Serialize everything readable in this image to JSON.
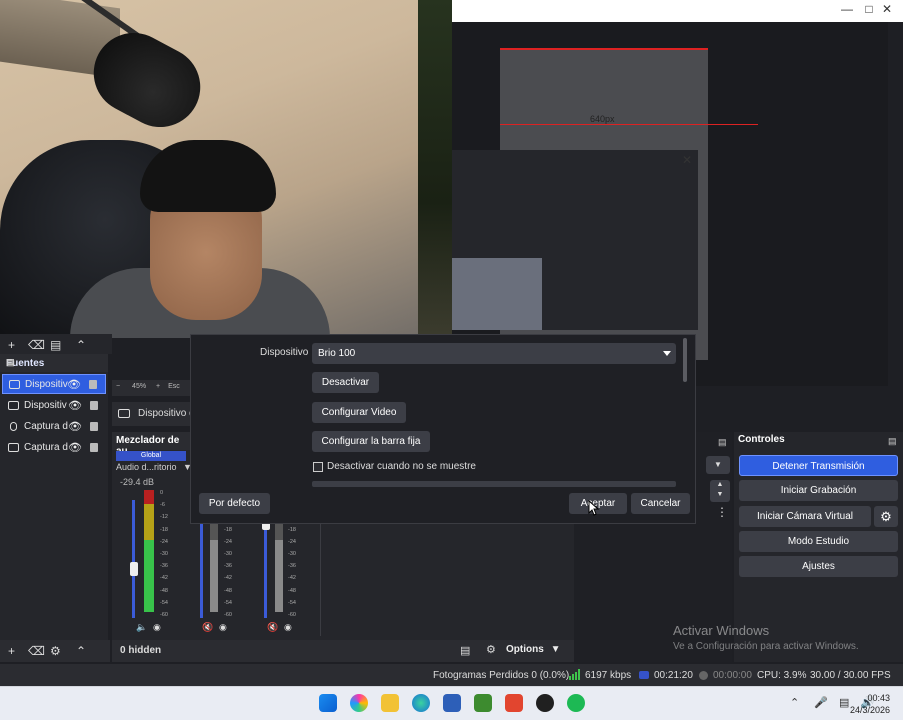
{
  "obs": {
    "sources": {
      "title": "Fuentes",
      "items": [
        {
          "label": "Dispositiv",
          "selected": true,
          "icon": "camera-icon"
        },
        {
          "label": "Dispositiv",
          "selected": false,
          "icon": "camera-icon"
        },
        {
          "label": "Captura d",
          "selected": false,
          "icon": "mic-icon"
        },
        {
          "label": "Captura d",
          "selected": false,
          "icon": "monitor-icon"
        }
      ]
    },
    "preview_zoom": "45%",
    "preview_zoom_suffix": "Esc",
    "nested_resolution": "640px",
    "properties_source": "Dispositivo d",
    "mixer": {
      "title": "Mezclador de au",
      "global_tag": "Global",
      "channel_name": "Audio d...ritorio",
      "db_value": "-29.4 dB",
      "scale": [
        "0",
        "-6",
        "-12",
        "-18",
        "-24",
        "-30",
        "-36",
        "-42",
        "-48",
        "-54",
        "-60"
      ],
      "hidden_label": "0 hidden",
      "options_label": "Options"
    },
    "dialog": {
      "device_label": "Dispositivo",
      "device_value": "Brio 100",
      "buttons": {
        "deactivate": "Desactivar",
        "configure_video": "Configurar Video",
        "configure_bar": "Configurar la barra fija"
      },
      "checkbox_label": "Desactivar cuando no se muestre",
      "defaults": "Por defecto",
      "accept": "Aceptar",
      "cancel": "Cancelar"
    },
    "controls": {
      "title": "Controles",
      "stop_stream": "Detener Transmisión",
      "start_recording": "Iniciar Grabación",
      "start_virtual_cam": "Iniciar Cámara Virtual",
      "studio_mode": "Modo Estudio",
      "settings": "Ajustes"
    },
    "status": {
      "dropped_frames": "Fotogramas Perdidos 0 (0.0%)",
      "bitrate": "6197 kbps",
      "stream_time": "00:21:20",
      "record_time": "00:00:00",
      "cpu": "CPU: 3.9%",
      "fps": "30.00 / 30.00 FPS"
    }
  },
  "watermark": {
    "line1": "Activar Windows",
    "line2": "Ve a Configuración para activar Windows."
  },
  "taskbar": {
    "time": "00:43",
    "date": "24/3/2026"
  },
  "colors": {
    "accent": "#2f5ee0",
    "panel": "#25262b",
    "stream_green": "#3fc24c",
    "record_red": "#d22"
  }
}
